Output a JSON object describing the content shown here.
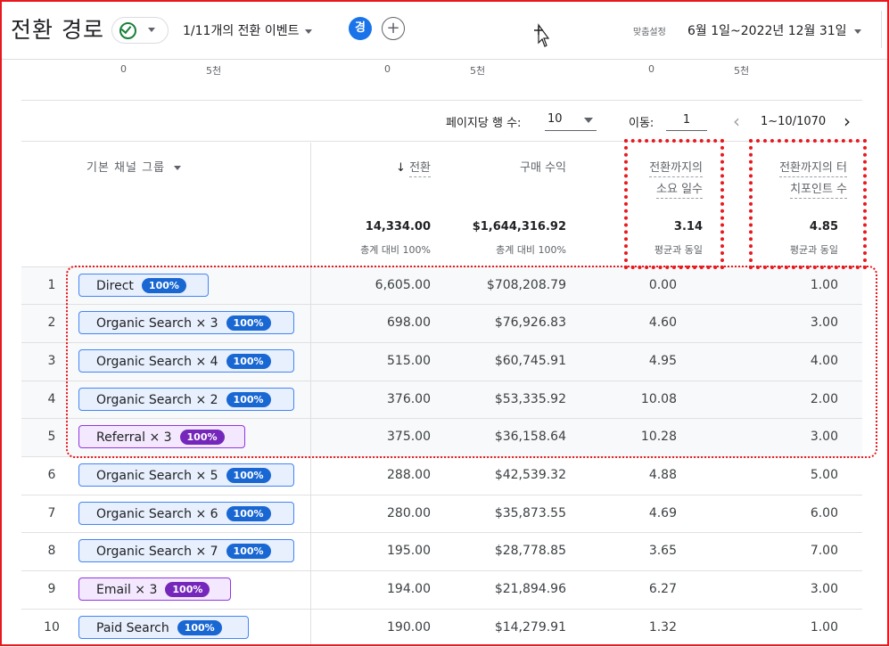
{
  "header": {
    "title": "전환 경로",
    "events_label": "1/11개의 전환 이벤트",
    "avatar_letter": "경",
    "add_symbol": "+",
    "custom_label": "맞춤설정",
    "date_range": "6월 1일~2022년 12월 31일"
  },
  "axis_ticks": [
    "0",
    "5천",
    "0",
    "5천",
    "0",
    "5천"
  ],
  "pagination": {
    "rows_per_page_label": "페이지당 행 수:",
    "rows_per_page_value": "10",
    "goto_label": "이동:",
    "goto_value": "1",
    "page_range": "1~10/1070",
    "prev_icon": "‹",
    "next_icon": "›"
  },
  "table": {
    "dimension_header": "기본 채널 그룹",
    "columns": [
      {
        "arrow": "↓",
        "label": "전환"
      },
      {
        "label": "구매 수익"
      },
      {
        "line1": "전환까지의",
        "line2": "소요 일수"
      },
      {
        "line1": "전환까지의 터",
        "line2": "치포인트 수"
      }
    ],
    "totals": [
      {
        "value": "14,334.00",
        "sub": "총계 대비 100%"
      },
      {
        "value": "$1,644,316.92",
        "sub": "총계 대비 100%"
      },
      {
        "value": "3.14",
        "sub": "평균과 동일"
      },
      {
        "value": "4.85",
        "sub": "평균과 동일"
      }
    ],
    "rows": [
      {
        "num": "1",
        "channel": "Direct",
        "badge": "100%",
        "color": "blue",
        "conversions": "6,605.00",
        "revenue": "$708,208.79",
        "days": "0.00",
        "touchpoints": "1.00"
      },
      {
        "num": "2",
        "channel": "Organic Search × 3",
        "badge": "100%",
        "color": "blue",
        "conversions": "698.00",
        "revenue": "$76,926.83",
        "days": "4.60",
        "touchpoints": "3.00"
      },
      {
        "num": "3",
        "channel": "Organic Search × 4",
        "badge": "100%",
        "color": "blue",
        "conversions": "515.00",
        "revenue": "$60,745.91",
        "days": "4.95",
        "touchpoints": "4.00"
      },
      {
        "num": "4",
        "channel": "Organic Search × 2",
        "badge": "100%",
        "color": "blue",
        "conversions": "376.00",
        "revenue": "$53,335.92",
        "days": "10.08",
        "touchpoints": "2.00"
      },
      {
        "num": "5",
        "channel": "Referral × 3",
        "badge": "100%",
        "color": "purple",
        "conversions": "375.00",
        "revenue": "$36,158.64",
        "days": "10.28",
        "touchpoints": "3.00"
      },
      {
        "num": "6",
        "channel": "Organic Search × 5",
        "badge": "100%",
        "color": "blue",
        "conversions": "288.00",
        "revenue": "$42,539.32",
        "days": "4.88",
        "touchpoints": "5.00"
      },
      {
        "num": "7",
        "channel": "Organic Search × 6",
        "badge": "100%",
        "color": "blue",
        "conversions": "280.00",
        "revenue": "$35,873.55",
        "days": "4.69",
        "touchpoints": "6.00"
      },
      {
        "num": "8",
        "channel": "Organic Search × 7",
        "badge": "100%",
        "color": "blue",
        "conversions": "195.00",
        "revenue": "$28,778.85",
        "days": "3.65",
        "touchpoints": "7.00"
      },
      {
        "num": "9",
        "channel": "Email × 3",
        "badge": "100%",
        "color": "purple",
        "conversions": "194.00",
        "revenue": "$21,894.96",
        "days": "6.27",
        "touchpoints": "3.00"
      },
      {
        "num": "10",
        "channel": "Paid Search",
        "badge": "100%",
        "color": "blue",
        "conversions": "190.00",
        "revenue": "$14,279.91",
        "days": "1.32",
        "touchpoints": "1.00"
      }
    ]
  },
  "colors": {
    "accent_blue": "#1967d2",
    "accent_purple": "#7627bb",
    "annotation_red": "#e8191e"
  }
}
